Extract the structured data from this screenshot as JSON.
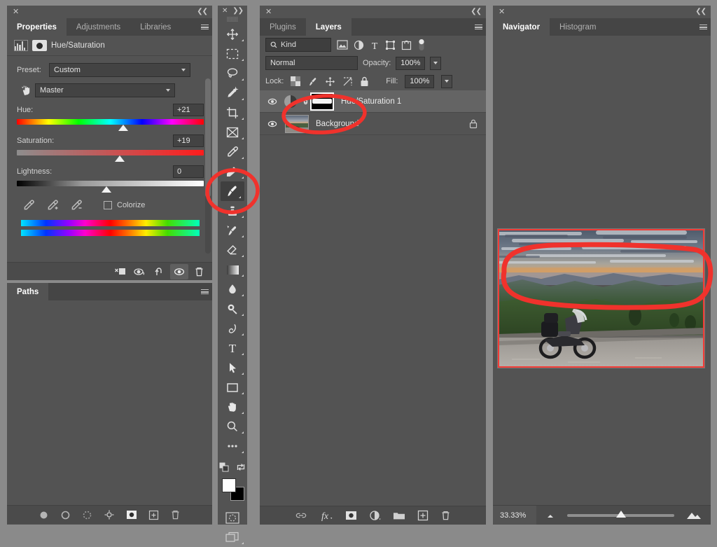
{
  "app": "Adobe Photoshop",
  "properties_panel": {
    "tabs": [
      {
        "label": "Properties",
        "active": true
      },
      {
        "label": "Adjustments",
        "active": false
      },
      {
        "label": "Libraries",
        "active": false
      }
    ],
    "header_title": "Hue/Saturation",
    "preset_label": "Preset:",
    "preset_value": "Custom",
    "channel_value": "Master",
    "sliders": [
      {
        "label": "Hue:",
        "value": "+21",
        "thumb_pct": 57
      },
      {
        "label": "Saturation:",
        "value": "+19",
        "thumb_pct": 55
      },
      {
        "label": "Lightness:",
        "value": "0",
        "thumb_pct": 48
      }
    ],
    "colorize_label": "Colorize",
    "colorize_checked": false,
    "footer_icons": [
      {
        "name": "clip-to-layer-icon",
        "active": false
      },
      {
        "name": "view-previous-state-icon",
        "active": false
      },
      {
        "name": "reset-icon",
        "active": false
      },
      {
        "name": "toggle-visibility-icon",
        "active": true
      },
      {
        "name": "delete-adjustment-icon",
        "active": false
      }
    ]
  },
  "paths_panel": {
    "tabs": [
      {
        "label": "Paths",
        "active": true
      }
    ],
    "footer_icons": [
      "fill-path-icon",
      "stroke-path-icon",
      "load-selection-icon",
      "make-work-path-icon",
      "add-mask-icon",
      "new-path-icon",
      "delete-path-icon"
    ]
  },
  "toolbar": {
    "tools": [
      {
        "name": "move-tool",
        "selected": false
      },
      {
        "name": "rectangular-marquee-tool",
        "selected": false
      },
      {
        "name": "lasso-tool",
        "selected": false
      },
      {
        "name": "object-selection-tool",
        "selected": false
      },
      {
        "name": "crop-tool",
        "selected": false
      },
      {
        "name": "frame-tool",
        "selected": false
      },
      {
        "name": "eyedropper-tool",
        "selected": false
      },
      {
        "name": "healing-brush-tool",
        "selected": false
      },
      {
        "name": "brush-tool",
        "selected": true
      },
      {
        "name": "clone-stamp-tool",
        "selected": false
      },
      {
        "name": "history-brush-tool",
        "selected": false
      },
      {
        "name": "eraser-tool",
        "selected": false
      },
      {
        "name": "gradient-tool",
        "selected": false
      },
      {
        "name": "blur-tool",
        "selected": false
      },
      {
        "name": "dodge-tool",
        "selected": false
      },
      {
        "name": "pen-tool",
        "selected": false
      },
      {
        "name": "type-tool",
        "selected": false
      },
      {
        "name": "path-selection-tool",
        "selected": false
      },
      {
        "name": "rectangle-tool",
        "selected": false
      },
      {
        "name": "hand-tool",
        "selected": false
      },
      {
        "name": "zoom-tool",
        "selected": false
      },
      {
        "name": "edit-toolbar-icon",
        "selected": false
      }
    ],
    "foreground_color": "#ffffff",
    "background_color": "#000000"
  },
  "layers_panel": {
    "tabs": [
      {
        "label": "Plugins",
        "active": false
      },
      {
        "label": "Layers",
        "active": true
      }
    ],
    "filter": {
      "kind_label": "Kind",
      "icons": [
        "filter-pixel-icon",
        "filter-adjustment-icon",
        "filter-type-icon",
        "filter-shape-icon",
        "filter-smart-object-icon"
      ],
      "toggle_on": false
    },
    "blend_mode": "Normal",
    "opacity_label": "Opacity:",
    "opacity_value": "100%",
    "lock_label": "Lock:",
    "lock_icons": [
      "lock-transparent-pixels-icon",
      "lock-image-pixels-icon",
      "lock-position-icon",
      "lock-artboard-icon",
      "lock-all-icon"
    ],
    "fill_label": "Fill:",
    "fill_value": "100%",
    "layers": [
      {
        "name": "Hue/Saturation 1",
        "visible": true,
        "selected": true,
        "type": "adjustment",
        "has_mask": true,
        "linked": true,
        "locked": false
      },
      {
        "name": "Background",
        "visible": true,
        "selected": false,
        "type": "image",
        "has_mask": false,
        "linked": false,
        "locked": true
      }
    ],
    "footer_icons": [
      "link-layers-icon",
      "layer-style-fx-icon",
      "add-layer-mask-icon",
      "new-adjustment-layer-icon",
      "new-group-icon",
      "new-layer-icon",
      "delete-layer-icon"
    ]
  },
  "navigator_panel": {
    "tabs": [
      {
        "label": "Navigator",
        "active": true
      },
      {
        "label": "Histogram",
        "active": false
      }
    ],
    "zoom_value": "33.33%",
    "zoom_out_icon": "zoom-out-mountain-icon",
    "zoom_in_icon": "zoom-in-mountain-icon",
    "slider_pct": 50,
    "image_description": "motorcycle at mountain overlook at sunset"
  },
  "annotations": {
    "color": "#f0322c",
    "marks": [
      {
        "name": "brush-tool-highlight",
        "shape": "ellipse"
      },
      {
        "name": "layer-mask-highlight",
        "shape": "ellipse"
      },
      {
        "name": "navigator-region-highlight",
        "shape": "freeform-ellipse"
      }
    ]
  }
}
